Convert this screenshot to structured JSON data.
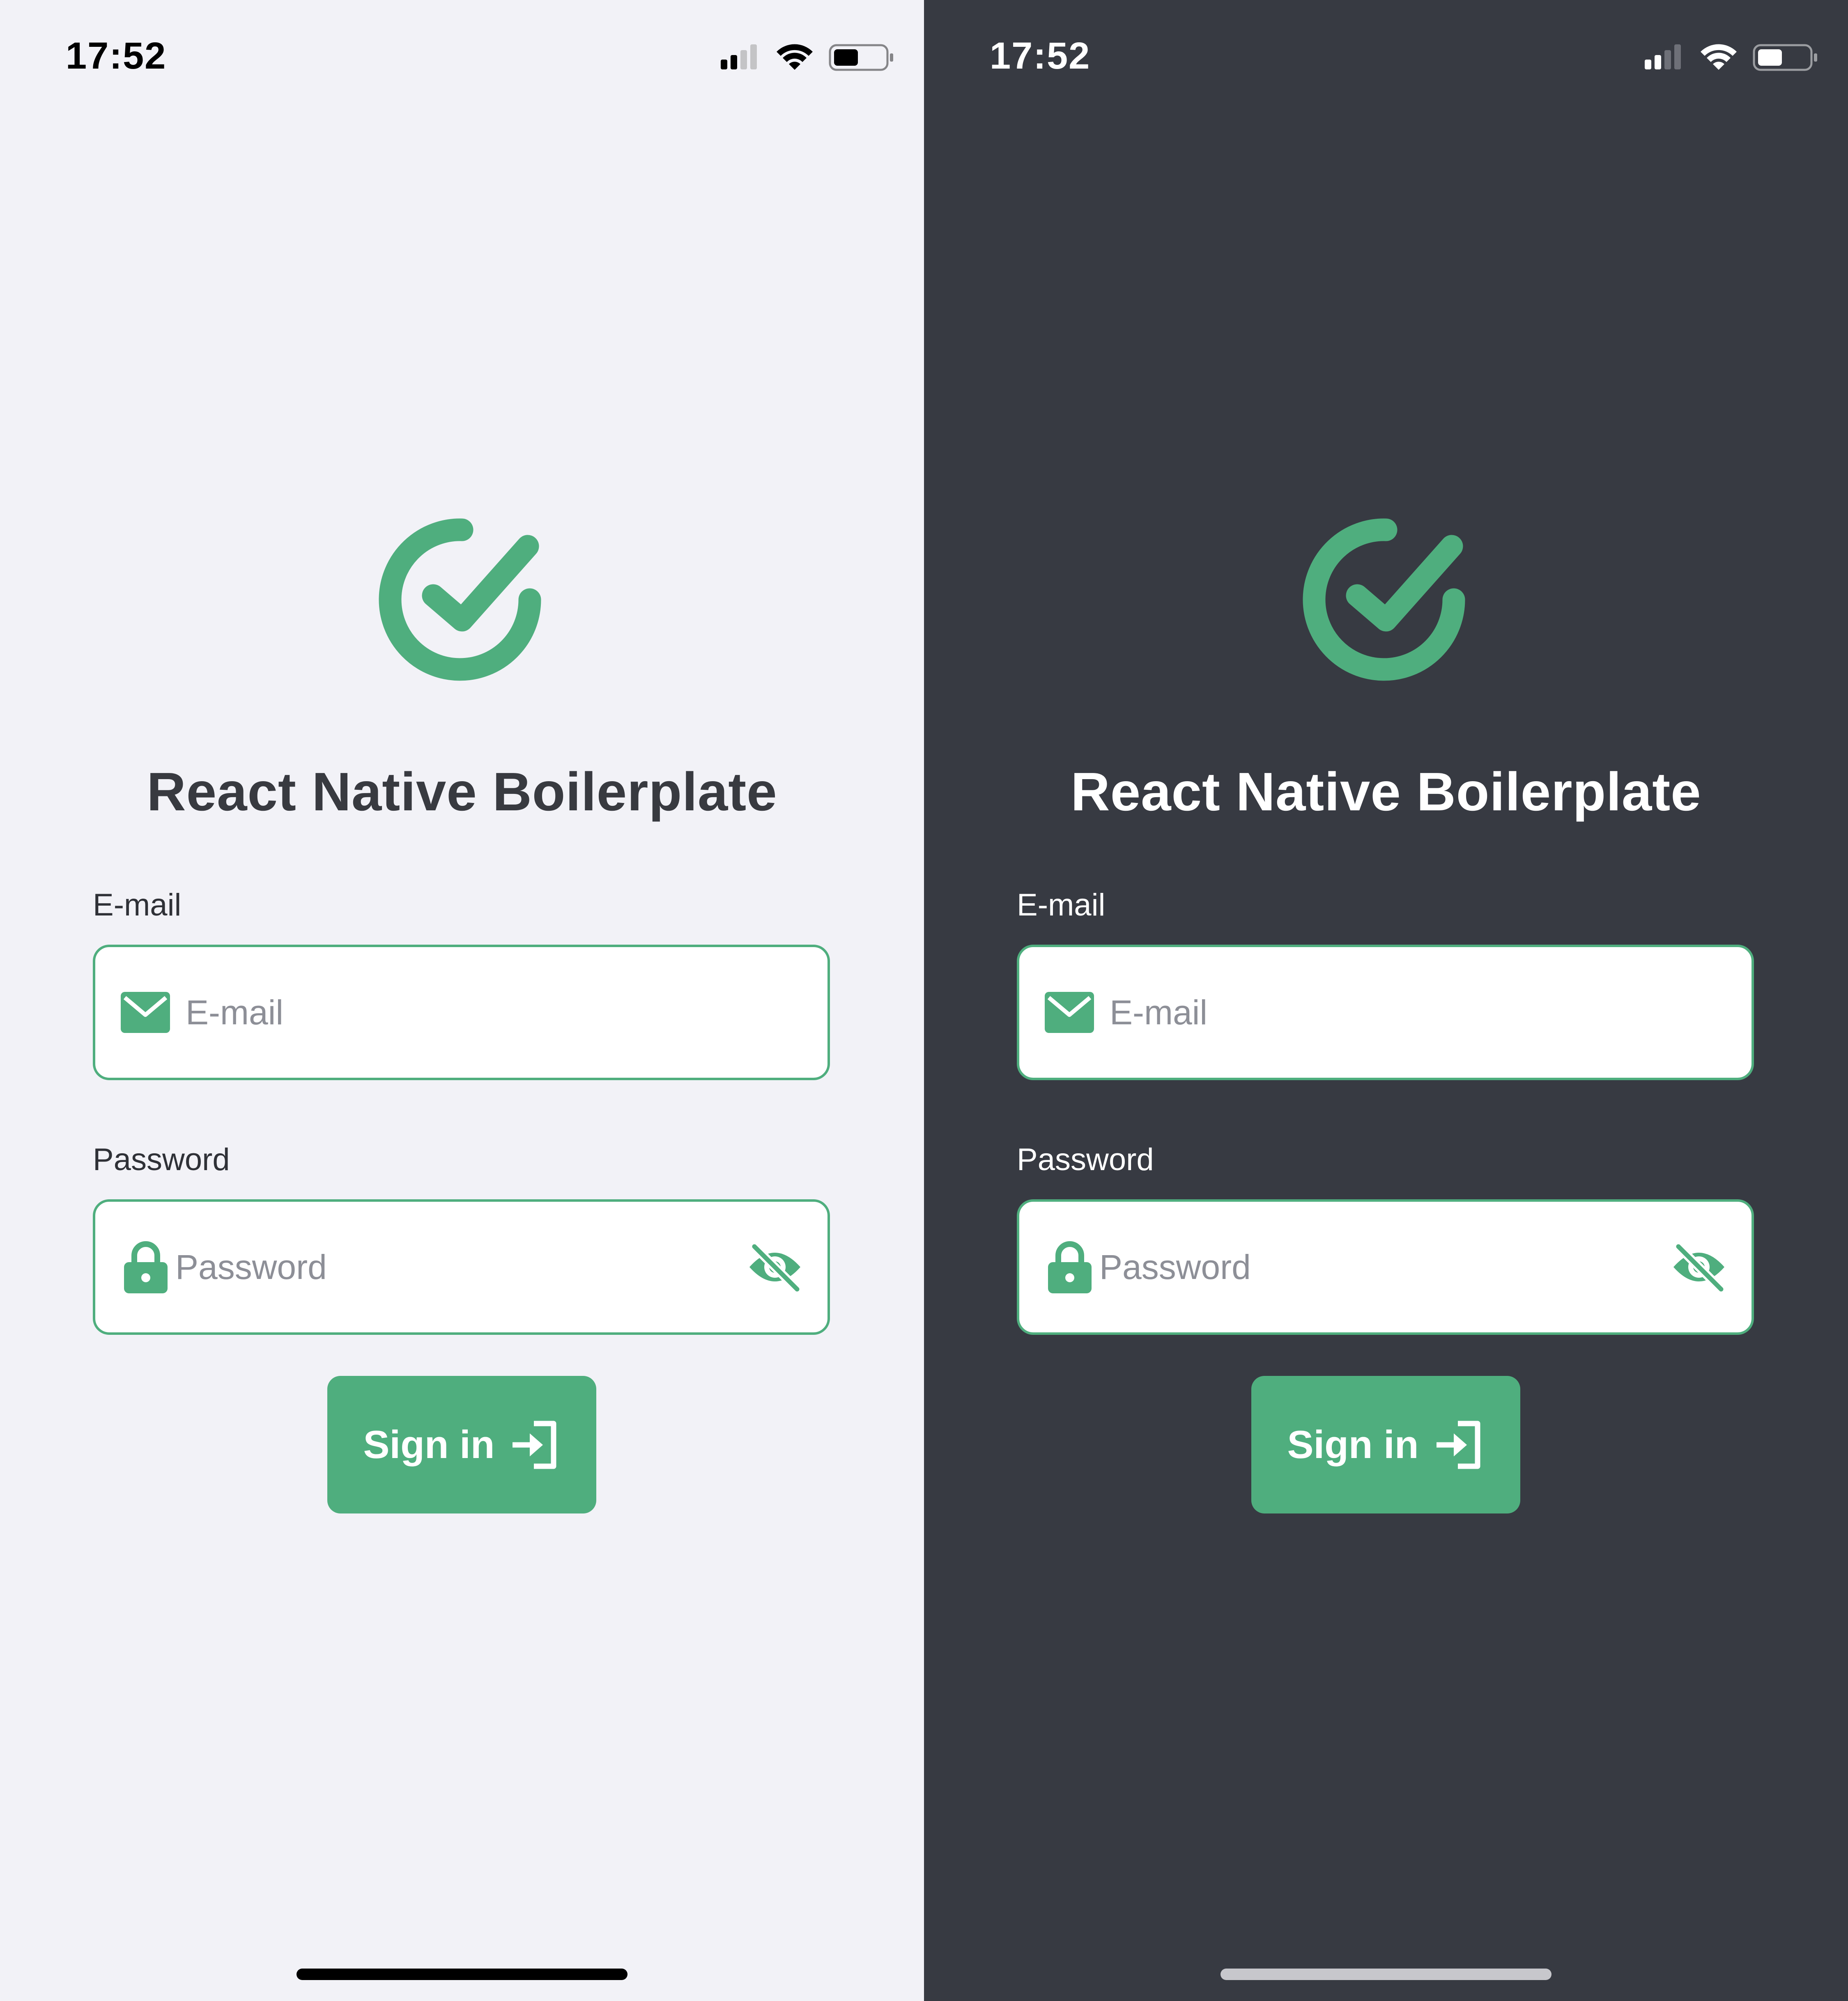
{
  "colors": {
    "accent": "#4fae7e",
    "light_background": "#f2f2f7",
    "dark_background": "#373a42",
    "input_background": "#ffffff",
    "placeholder": "#8d8f97"
  },
  "screens": [
    {
      "theme": "light",
      "status_bar": {
        "time": "17:52",
        "icons": [
          "signal-icon",
          "wifi-icon",
          "battery-icon"
        ]
      },
      "logo_icon": "check-circle-icon",
      "title": "React Native Boilerplate",
      "email": {
        "label": "E-mail",
        "placeholder": "E-mail",
        "value": "",
        "icon": "mail-icon"
      },
      "password": {
        "label": "Password",
        "placeholder": "Password",
        "value": "",
        "icon": "lock-icon",
        "toggle_icon": "eye-off-icon"
      },
      "signin": {
        "label": "Sign in",
        "icon": "sign-in-icon"
      }
    },
    {
      "theme": "dark",
      "status_bar": {
        "time": "17:52",
        "icons": [
          "signal-icon",
          "wifi-icon",
          "battery-icon"
        ]
      },
      "logo_icon": "check-circle-icon",
      "title": "React Native Boilerplate",
      "email": {
        "label": "E-mail",
        "placeholder": "E-mail",
        "value": "",
        "icon": "mail-icon"
      },
      "password": {
        "label": "Password",
        "placeholder": "Password",
        "value": "",
        "icon": "lock-icon",
        "toggle_icon": "eye-off-icon"
      },
      "signin": {
        "label": "Sign in",
        "icon": "sign-in-icon"
      }
    }
  ]
}
